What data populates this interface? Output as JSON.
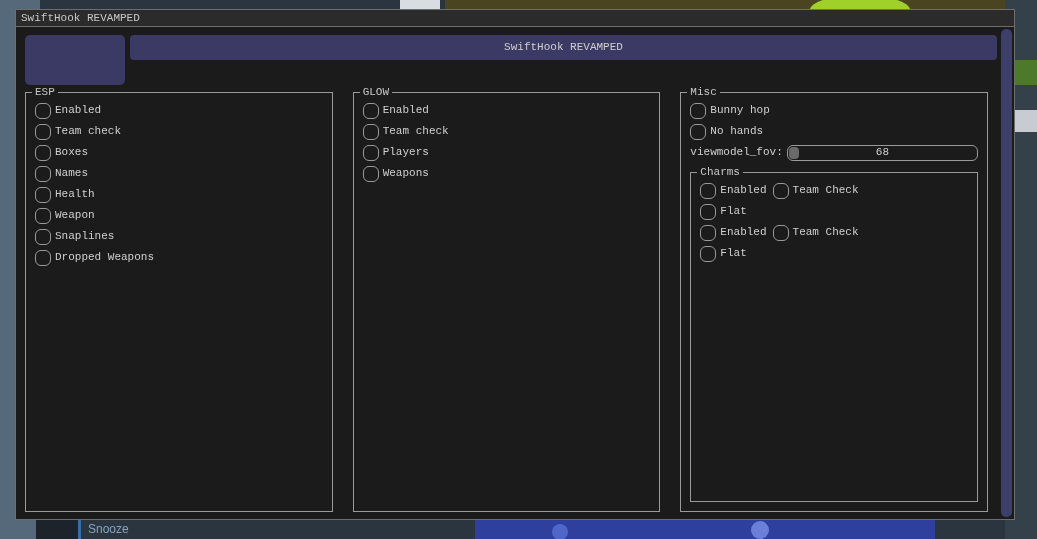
{
  "backdrop": {
    "label": "Snooze"
  },
  "window": {
    "title": "SwiftHook REVAMPED"
  },
  "header": {
    "title": "SwiftHook REVAMPED"
  },
  "panels": [
    {
      "title": "ESP",
      "items": [
        {
          "label": "Enabled",
          "checked": false
        },
        {
          "label": "Team check",
          "checked": false
        },
        {
          "label": "Boxes",
          "checked": false
        },
        {
          "label": "Names",
          "checked": false
        },
        {
          "label": "Health",
          "checked": false
        },
        {
          "label": "Weapon",
          "checked": false
        },
        {
          "label": "Snaplines",
          "checked": false
        },
        {
          "label": "Dropped Weapons",
          "checked": false
        }
      ]
    },
    {
      "title": "GLOW",
      "items": [
        {
          "label": "Enabled",
          "checked": false
        },
        {
          "label": "Team check",
          "checked": false
        },
        {
          "label": "Players",
          "checked": false
        },
        {
          "label": "Weapons",
          "checked": false
        }
      ]
    }
  ],
  "misc": {
    "title": "Misc",
    "items": [
      {
        "label": "Bunny hop",
        "checked": false
      },
      {
        "label": "No hands",
        "checked": false
      }
    ],
    "slider": {
      "label": "viewmodel_fov:",
      "level": 0,
      "reading": "68"
    },
    "charms": {
      "title": "Charms",
      "rows": [
        [
          {
            "label": "Enabled",
            "checked": false
          },
          {
            "label": "Team Check",
            "checked": false
          }
        ],
        [
          {
            "label": "Flat",
            "checked": false
          }
        ],
        [
          {
            "label": "Enabled",
            "checked": false
          },
          {
            "label": "Team Check",
            "checked": false
          }
        ],
        [
          {
            "label": "Flat",
            "checked": false
          }
        ]
      ]
    }
  }
}
